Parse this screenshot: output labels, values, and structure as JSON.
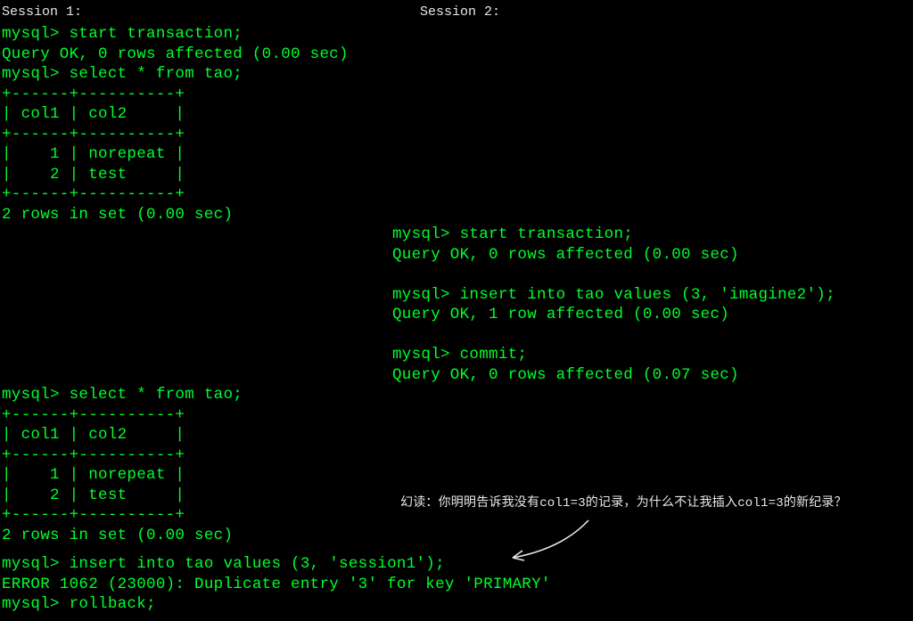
{
  "session1": {
    "label": "Session 1:",
    "block1": "mysql> start transaction;\nQuery OK, 0 rows affected (0.00 sec)\nmysql> select * from tao;\n+------+----------+\n| col1 | col2     |\n+------+----------+\n|    1 | norepeat |\n|    2 | test     |\n+------+----------+\n2 rows in set (0.00 sec)",
    "block2": "mysql> select * from tao;\n+------+----------+\n| col1 | col2     |\n+------+----------+\n|    1 | norepeat |\n|    2 | test     |\n+------+----------+\n2 rows in set (0.00 sec)",
    "block3": "mysql> insert into tao values (3, 'session1');\nERROR 1062 (23000): Duplicate entry '3' for key 'PRIMARY'\nmysql> rollback;"
  },
  "session2": {
    "label": "Session 2:",
    "block1": "mysql> start transaction;\nQuery OK, 0 rows affected (0.00 sec)\n\nmysql> insert into tao values (3, 'imagine2');\nQuery OK, 1 row affected (0.00 sec)\n\nmysql> commit;\nQuery OK, 0 rows affected (0.07 sec)"
  },
  "annotation": {
    "text": "幻读：你明明告诉我没有col1=3的记录，为什么不让我插入col1=3的新纪录？"
  }
}
